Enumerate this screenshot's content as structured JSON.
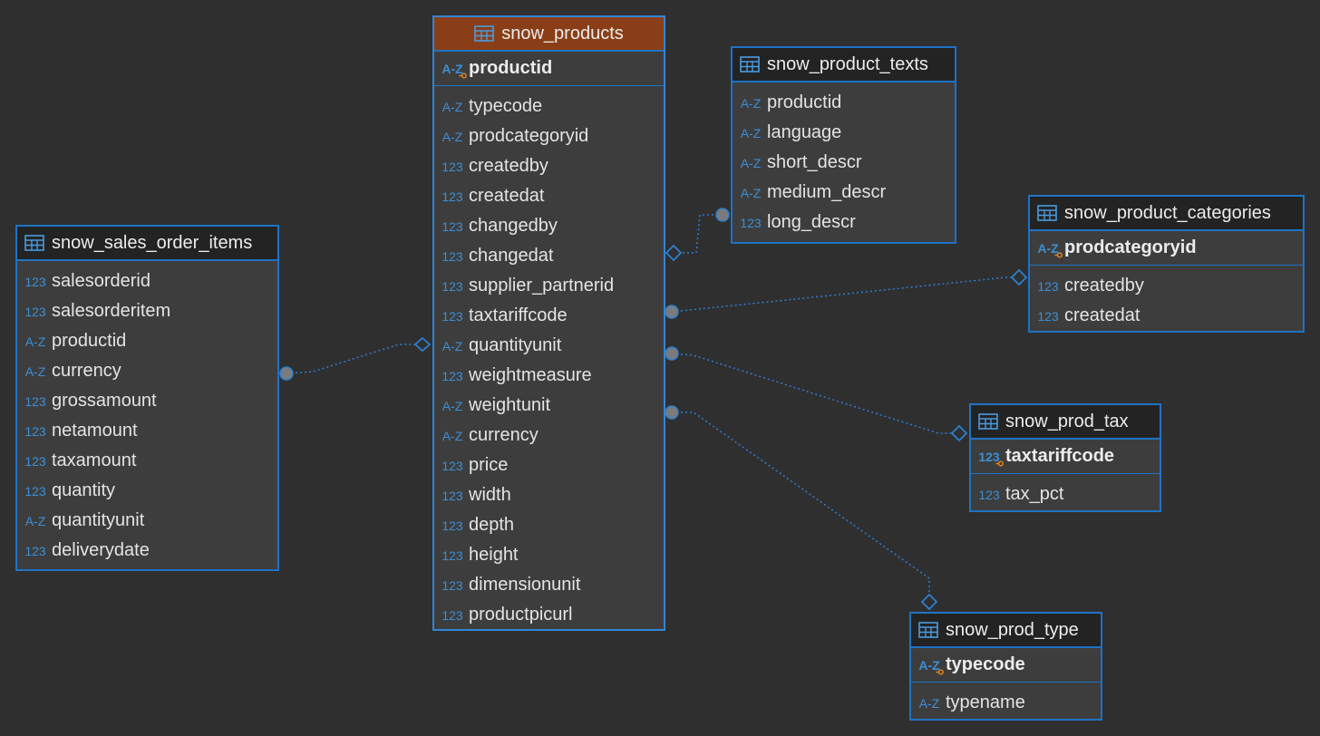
{
  "colors": {
    "background": "#2f2f2f",
    "entity_border": "#1f73c4",
    "entity_fill": "#3d3d3d",
    "header_fill": "#232323",
    "selected_header_fill": "#8a3e17",
    "type_glyph": "#3d8fd6",
    "key_marker": "#e8891c",
    "link": "#2e7fd0"
  },
  "entities": {
    "products": {
      "name": "snow_products",
      "key": {
        "type": "A-Z",
        "name": "productid"
      },
      "columns": [
        {
          "type": "A-Z",
          "name": "typecode"
        },
        {
          "type": "A-Z",
          "name": "prodcategoryid"
        },
        {
          "type": "123",
          "name": "createdby"
        },
        {
          "type": "123",
          "name": "createdat"
        },
        {
          "type": "123",
          "name": "changedby"
        },
        {
          "type": "123",
          "name": "changedat"
        },
        {
          "type": "123",
          "name": "supplier_partnerid"
        },
        {
          "type": "123",
          "name": "taxtariffcode"
        },
        {
          "type": "A-Z",
          "name": "quantityunit"
        },
        {
          "type": "123",
          "name": "weightmeasure"
        },
        {
          "type": "A-Z",
          "name": "weightunit"
        },
        {
          "type": "A-Z",
          "name": "currency"
        },
        {
          "type": "123",
          "name": "price"
        },
        {
          "type": "123",
          "name": "width"
        },
        {
          "type": "123",
          "name": "depth"
        },
        {
          "type": "123",
          "name": "height"
        },
        {
          "type": "123",
          "name": "dimensionunit"
        },
        {
          "type": "123",
          "name": "productpicurl"
        }
      ]
    },
    "sales_order_items": {
      "name": "snow_sales_order_items",
      "columns": [
        {
          "type": "123",
          "name": "salesorderid"
        },
        {
          "type": "123",
          "name": "salesorderitem"
        },
        {
          "type": "A-Z",
          "name": "productid"
        },
        {
          "type": "A-Z",
          "name": "currency"
        },
        {
          "type": "123",
          "name": "grossamount"
        },
        {
          "type": "123",
          "name": "netamount"
        },
        {
          "type": "123",
          "name": "taxamount"
        },
        {
          "type": "123",
          "name": "quantity"
        },
        {
          "type": "A-Z",
          "name": "quantityunit"
        },
        {
          "type": "123",
          "name": "deliverydate"
        }
      ]
    },
    "product_texts": {
      "name": "snow_product_texts",
      "columns": [
        {
          "type": "A-Z",
          "name": "productid"
        },
        {
          "type": "A-Z",
          "name": "language"
        },
        {
          "type": "A-Z",
          "name": "short_descr"
        },
        {
          "type": "A-Z",
          "name": "medium_descr"
        },
        {
          "type": "123",
          "name": "long_descr"
        }
      ]
    },
    "product_categories": {
      "name": "snow_product_categories",
      "key": {
        "type": "A-Z",
        "name": "prodcategoryid"
      },
      "columns": [
        {
          "type": "123",
          "name": "createdby"
        },
        {
          "type": "123",
          "name": "createdat"
        }
      ]
    },
    "prod_tax": {
      "name": "snow_prod_tax",
      "key": {
        "type": "123",
        "name": "taxtariffcode"
      },
      "columns": [
        {
          "type": "123",
          "name": "tax_pct"
        }
      ]
    },
    "prod_type": {
      "name": "snow_prod_type",
      "key": {
        "type": "A-Z",
        "name": "typecode"
      },
      "columns": [
        {
          "type": "A-Z",
          "name": "typename"
        }
      ]
    }
  }
}
